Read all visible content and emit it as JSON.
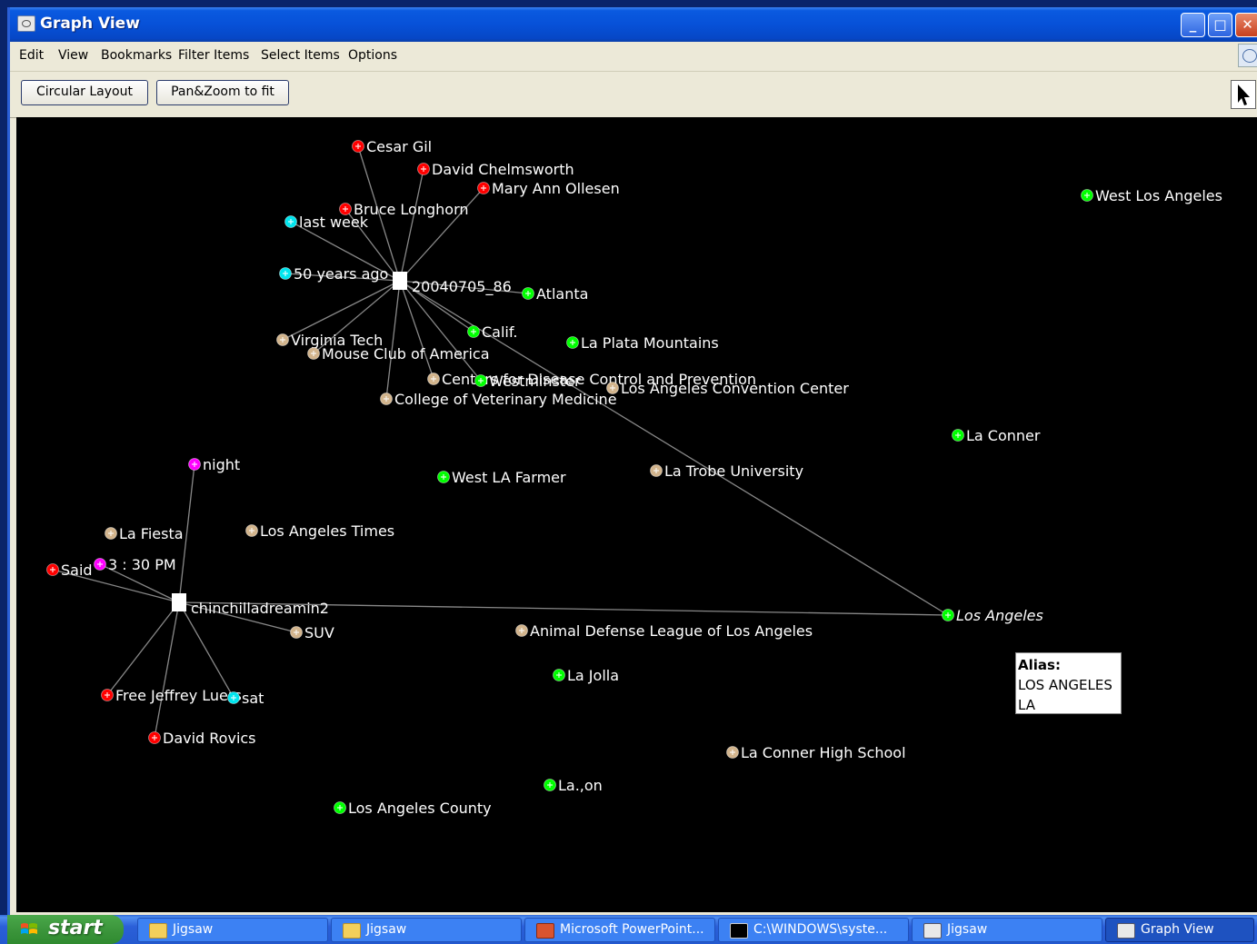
{
  "window": {
    "title": "Graph View",
    "controls": {
      "minimize": "_",
      "maximize": "□",
      "close": "✕"
    }
  },
  "menu": [
    "Edit",
    "View",
    "Bookmarks",
    "Filter Items",
    "Select Items",
    "Options"
  ],
  "toolbar": {
    "circular_layout": "Circular Layout",
    "pan_zoom": "Pan&Zoom to fit"
  },
  "legend_colors": {
    "person": "#ff0000",
    "date": "#00e5ee",
    "place": "#00ff00",
    "organization": "#d2b48c",
    "time": "#ff00ff",
    "document": "#ffffff",
    "edge": "#888888",
    "label": "#ffffff"
  },
  "graph": {
    "documents": [
      "20040705_86",
      "chinchilladreamin2"
    ],
    "entities": [
      {
        "label": "Cesar Gil",
        "type": "person"
      },
      {
        "label": "David Chelmsworth",
        "type": "person"
      },
      {
        "label": "Mary Ann Ollesen",
        "type": "person"
      },
      {
        "label": "Bruce Longhorn",
        "type": "person"
      },
      {
        "label": "last week",
        "type": "date"
      },
      {
        "label": "50 years ago",
        "type": "date"
      },
      {
        "label": "Atlanta",
        "type": "place"
      },
      {
        "label": "Calif.",
        "type": "place"
      },
      {
        "label": "Virginia Tech",
        "type": "organization"
      },
      {
        "label": "Mouse Club of America",
        "type": "organization"
      },
      {
        "label": "Centers for Disease Control and Prevention",
        "type": "organization"
      },
      {
        "label": "Westminster",
        "type": "place"
      },
      {
        "label": "College of Veterinary Medicine",
        "type": "organization"
      },
      {
        "label": "Los Angeles Convention Center",
        "type": "organization"
      },
      {
        "label": "La Plata Mountains",
        "type": "place"
      },
      {
        "label": "West Los Angeles",
        "type": "place"
      },
      {
        "label": "La Conner",
        "type": "place"
      },
      {
        "label": "West LA Farmer",
        "type": "place"
      },
      {
        "label": "La Trobe University",
        "type": "organization"
      },
      {
        "label": "night",
        "type": "time"
      },
      {
        "label": "La Fiesta",
        "type": "organization"
      },
      {
        "label": "Los Angeles Times",
        "type": "organization"
      },
      {
        "label": "Said",
        "type": "person"
      },
      {
        "label": "3 : 30 PM",
        "type": "time"
      },
      {
        "label": "SUV",
        "type": "organization"
      },
      {
        "label": "Animal Defense League of Los Angeles",
        "type": "organization"
      },
      {
        "label": "Los Angeles",
        "type": "place"
      },
      {
        "label": "La Jolla",
        "type": "place"
      },
      {
        "label": "Free Jeffrey Luers",
        "type": "person"
      },
      {
        "label": "sat",
        "type": "date"
      },
      {
        "label": "David Rovics",
        "type": "person"
      },
      {
        "label": "La Conner High School",
        "type": "organization"
      },
      {
        "label": "La.,on",
        "type": "place"
      },
      {
        "label": "Los Angeles County",
        "type": "place"
      }
    ]
  },
  "tooltip": {
    "title": "Alias:",
    "lines": [
      "LOS ANGELES",
      "LA"
    ]
  },
  "taskbar": {
    "start": "start",
    "tasks": [
      {
        "label": "Jigsaw",
        "icon": "folder-icon"
      },
      {
        "label": "Jigsaw",
        "icon": "folder-icon"
      },
      {
        "label": "Microsoft PowerPoint...",
        "icon": "powerpoint-icon"
      },
      {
        "label": "C:\\WINDOWS\\syste...",
        "icon": "cmd-icon"
      },
      {
        "label": "Jigsaw",
        "icon": "app-icon"
      },
      {
        "label": "Graph View",
        "icon": "app-icon",
        "active": true
      }
    ]
  }
}
